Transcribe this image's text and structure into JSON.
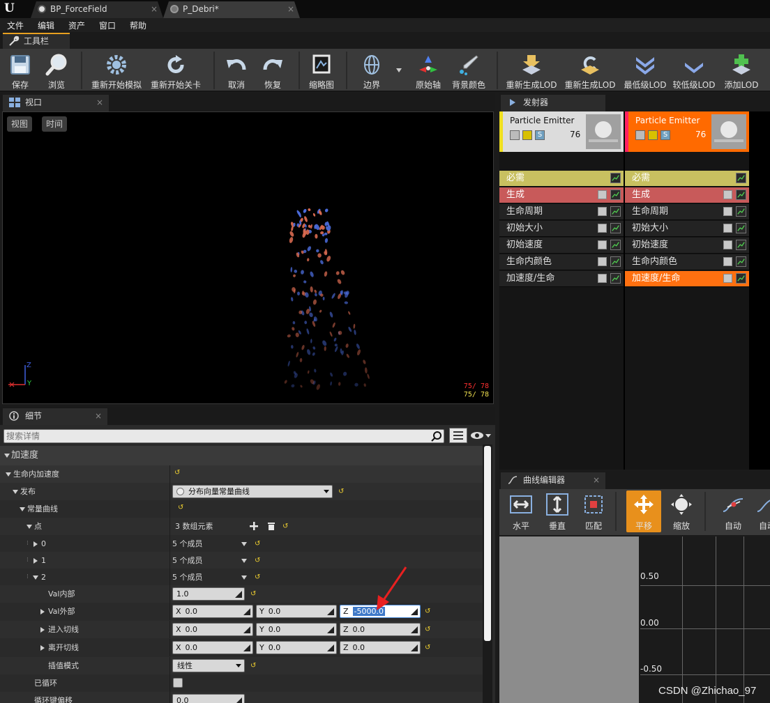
{
  "tabs": [
    {
      "label": "BP_ForceField",
      "close": "×"
    },
    {
      "label": "P_Debri*",
      "close": "×"
    }
  ],
  "menu": [
    "文件",
    "编辑",
    "资产",
    "窗口",
    "帮助"
  ],
  "toolbar_tab": "工具栏",
  "toolbar": {
    "save": "保存",
    "browse": "浏览",
    "restart_sim": "重新开始模拟",
    "restart_level": "重新开始关卡",
    "undo": "取消",
    "redo": "恢复",
    "thumbnail": "缩略图",
    "bounds": "边界",
    "origin_axis": "原始轴",
    "bg_color": "背景颜色",
    "regen_lod_1": "重新生成LOD",
    "regen_lod_2": "重新生成LOD",
    "lowest_lod": "最低级LOD",
    "lower_lod": "较低级LOD",
    "add_lod": "添加LOD"
  },
  "viewport": {
    "tab": "视口",
    "close": "×",
    "view_btn": "视图",
    "time_btn": "时间",
    "axis_z": "Z",
    "axis_y": "Y",
    "stat1": "75/ 78",
    "stat2": "75/ 78"
  },
  "emitter": {
    "tab": "发射器",
    "columns": [
      {
        "title": "Particle Emitter",
        "count": "76",
        "accent": "#f0e020"
      },
      {
        "title": "Particle Emitter",
        "count": "76",
        "accent": "#ff2060"
      }
    ],
    "modules": [
      "必需",
      "生成",
      "生命周期",
      "初始大小",
      "初始速度",
      "生命内颜色",
      "加速度/生命"
    ]
  },
  "details": {
    "tab": "细节",
    "close": "×",
    "search_placeholder": "搜索详情",
    "rows": {
      "accel": "加速度",
      "accel_over_life": "生命内加速度",
      "distribution": "发布",
      "distribution_value": "分布向量常量曲线",
      "const_curve": "常量曲线",
      "points": "点",
      "points_value": "3 数组元素",
      "p0": "0",
      "p0_value": "5 个成员",
      "p1": "1",
      "p1_value": "5 个成员",
      "p2": "2",
      "p2_value": "5 个成员",
      "in_val": "Val内部",
      "in_val_value": "1.0",
      "out_val": "Val外部",
      "out_x": "0.0",
      "out_y": "0.0",
      "out_z": "-5000.0",
      "arrive_tangent": "进入切线",
      "arrive_x": "0.0",
      "arrive_y": "0.0",
      "arrive_z": "0.0",
      "leave_tangent": "离开切线",
      "leave_x": "0.0",
      "leave_y": "0.0",
      "leave_z": "0.0",
      "interp_mode": "插值模式",
      "interp_value": "线性",
      "is_looped": "已循环",
      "loop_key_offset": "循环键偏移",
      "loop_key_offset_value": "0.0"
    },
    "vec_labels": [
      "X",
      "Y",
      "Z"
    ]
  },
  "curve_editor": {
    "tab": "曲线编辑器",
    "close": "×",
    "buttons": [
      "水平",
      "垂直",
      "匹配",
      "平移",
      "缩放",
      "自动",
      "自动"
    ],
    "y_labels": [
      "0.50",
      "0.00",
      "-0.50"
    ]
  },
  "watermark": "CSDN @Zhichao_97",
  "colors": {
    "accent_orange": "#e8901c",
    "required_row": "#c8c060",
    "spawn_row": "#c85a5a",
    "selected_row": "#ff7010"
  }
}
